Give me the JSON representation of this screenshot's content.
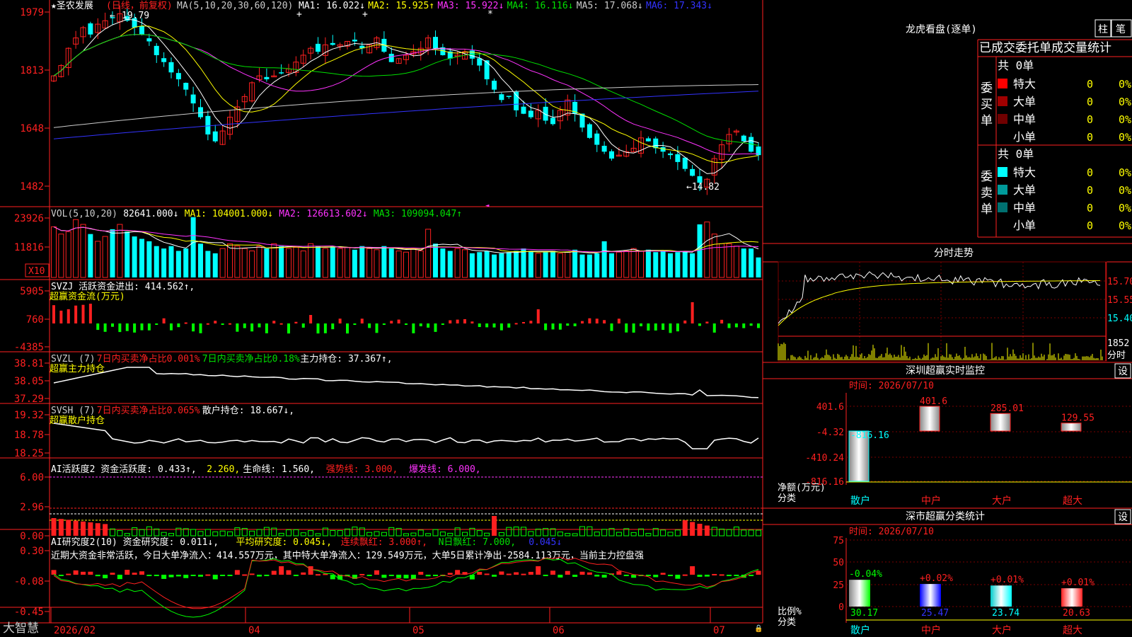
{
  "app": {
    "brand": "大智慧"
  },
  "stock": {
    "name": "★圣农发展",
    "period": "(日线，前复权)"
  },
  "price_panel": {
    "indicator": "MA(5,10,20,30,60,120)",
    "ma": [
      {
        "label": "MA1:",
        "value": "16.022",
        "arrow": "↓",
        "color": "#ffffff"
      },
      {
        "label": "MA2:",
        "value": "15.925",
        "arrow": "↑",
        "color": "#ffff00"
      },
      {
        "label": "MA3:",
        "value": "15.922",
        "arrow": "↓",
        "color": "#ff33ff"
      },
      {
        "label": "MA4:",
        "value": "16.116",
        "arrow": "↓",
        "color": "#00e000"
      },
      {
        "label": "MA5:",
        "value": "17.068",
        "arrow": "↓",
        "color": "#cccccc"
      },
      {
        "label": "MA6:",
        "value": "17.343",
        "arrow": "↓",
        "color": "#3333ff"
      }
    ],
    "yticks": [
      "1979",
      "1813",
      "1648",
      "1482"
    ],
    "high_label": "19.79",
    "low_label": "←14.82"
  },
  "vol_panel": {
    "header": [
      {
        "text": "VOL(5,10,20)",
        "color": "#cccccc"
      },
      {
        "text": "82641.000↓",
        "color": "#ffffff"
      },
      {
        "text": "MA1: 104001.000↓",
        "color": "#ffff00"
      },
      {
        "text": "MA2: 126613.602↓",
        "color": "#ff33ff"
      },
      {
        "text": "MA3: 109094.047↑",
        "color": "#00e000"
      }
    ],
    "yticks": [
      "23926",
      "11816"
    ],
    "unit": "X10"
  },
  "svzj_panel": {
    "header": [
      {
        "text": "SVZJ  活跃资金进出: 414.562↑,",
        "color": "#ffffff"
      }
    ],
    "subtitle": "超赢资金流(万元)",
    "yticks": [
      "5905",
      "760",
      "-4385"
    ]
  },
  "svzl_panel": {
    "header": [
      {
        "text": "SVZL (7)",
        "color": "#cccccc"
      },
      {
        "text": "7日内买卖净占比0.001%",
        "color": "#ff2020"
      },
      {
        "text": "7日内买卖净占比0.18%",
        "color": "#00e000"
      },
      {
        "text": "主力持仓: 37.367↑,",
        "color": "#ffffff"
      }
    ],
    "subtitle": "超赢主力持仓",
    "yticks": [
      "38.81",
      "38.05",
      "37.29"
    ]
  },
  "svsh_panel": {
    "header": [
      {
        "text": "SVSH (7)",
        "color": "#cccccc"
      },
      {
        "text": "7日内买卖净占比0.065%",
        "color": "#ff2020"
      },
      {
        "text": "散户持仓: 18.667↓,",
        "color": "#ffffff"
      }
    ],
    "subtitle": "超赢散户持仓",
    "yticks": [
      "19.32",
      "18.78",
      "18.25"
    ]
  },
  "ai2_panel": {
    "header": [
      {
        "text": "AI活跃度2 资金活跃度: 0.433↑,",
        "color": "#ffffff"
      },
      {
        "text": "2.260,",
        "color": "#ffff00"
      },
      {
        "text": "生命线: 1.560,",
        "color": "#ffffff"
      },
      {
        "text": "强势线: 3.000,",
        "color": "#ff2020"
      },
      {
        "text": "爆发线: 6.000,",
        "color": "#ff33ff"
      }
    ],
    "yticks": [
      "6.00",
      "2.96",
      "0.00"
    ]
  },
  "ai_research_panel": {
    "header": [
      {
        "text": "AI研究度2(10) 资金研究度: 0.011↓,",
        "color": "#ffffff"
      },
      {
        "text": "平均研究度: 0.045↓,",
        "color": "#ffff00"
      },
      {
        "text": "连续飘红: 3.000↑,",
        "color": "#ff2020"
      },
      {
        "text": "N日飘红: 7.000,",
        "color": "#00e000"
      },
      {
        "text": "0.045↓",
        "color": "#3333ff"
      }
    ],
    "comment": "近期大资金非常活跃，今日大单净流入：414.557万元，其中特大单净流入：129.549万元，大单5日累计净出-2584.113万元，当前主力控盘强",
    "yticks": [
      "0.30",
      "-0.08",
      "-0.45"
    ]
  },
  "xaxis": {
    "labels": [
      "2026/02",
      "04",
      "05",
      "06",
      "07"
    ]
  },
  "lhb": {
    "title": "龙虎看盘(逐单)",
    "tabs": [
      "柱",
      "笔"
    ],
    "stats_header": "已成交委托单成交量统计",
    "buy": {
      "label": "委买单",
      "count": "共 0单",
      "rows": [
        {
          "name": "特大",
          "count": "0",
          "pct": "0%",
          "color": "#ff0000"
        },
        {
          "name": "大单",
          "count": "0",
          "pct": "0%",
          "color": "#a00000"
        },
        {
          "name": "中单",
          "count": "0",
          "pct": "0%",
          "color": "#700000"
        },
        {
          "name": "小单",
          "count": "0",
          "pct": "0%",
          "color": "#000000"
        }
      ]
    },
    "sell": {
      "label": "委卖单",
      "count": "共 0单",
      "rows": [
        {
          "name": "特大",
          "count": "0",
          "pct": "0%",
          "color": "#00ffff"
        },
        {
          "name": "大单",
          "count": "0",
          "pct": "0%",
          "color": "#009a9a"
        },
        {
          "name": "中单",
          "count": "0",
          "pct": "0%",
          "color": "#007070"
        },
        {
          "name": "小单",
          "count": "0",
          "pct": "0%",
          "color": "#000000"
        }
      ]
    }
  },
  "intraday": {
    "title": "分时走势",
    "yticks": [
      "15.70",
      "15.55",
      "15.40"
    ],
    "vol_label": "1852",
    "side_label": "分时"
  },
  "sz_monitor": {
    "title": "深圳超赢实时监控",
    "settings": "设",
    "time": "时间: 2026/07/10",
    "yticks": [
      "401.6",
      "-4.32",
      "-410.24",
      "-816.16"
    ],
    "ylabel": [
      "净额(万元)",
      "分类"
    ],
    "categories": [
      "散户",
      "中户",
      "大户",
      "超大"
    ],
    "values": [
      "-816.16",
      "401.6",
      "285.01",
      "129.55"
    ]
  },
  "sz_class": {
    "title": "深市超赢分类统计",
    "settings": "设",
    "time": "时间: 2026/07/10",
    "yticks": [
      "75",
      "50",
      "25",
      "0"
    ],
    "ylabel": [
      "比例%",
      "分类"
    ],
    "categories": [
      "散户",
      "中户",
      "大户",
      "超大"
    ],
    "changes": [
      "-0.04%",
      "+0.02%",
      "+0.01%",
      "+0.01%"
    ],
    "values": [
      "30.17",
      "25.47",
      "23.74",
      "20.63"
    ]
  },
  "chart_data": [
    {
      "type": "candlestick",
      "title": "圣农发展 日线 前复权",
      "ylim": [
        14.5,
        20.0
      ],
      "x_labels": [
        "2026/02",
        "04",
        "05",
        "06",
        "07"
      ],
      "high": 19.79,
      "low": 14.82,
      "close": [
        18.0,
        18.3,
        18.8,
        19.1,
        19.4,
        19.2,
        19.5,
        19.6,
        19.7,
        19.8,
        19.6,
        19.4,
        19.2,
        19.0,
        18.6,
        18.4,
        18.1,
        17.9,
        17.6,
        17.2,
        16.8,
        16.3,
        16.1,
        16.4,
        16.8,
        17.1,
        17.4,
        17.8,
        18.0,
        17.9,
        18.0,
        18.1,
        18.2,
        18.4,
        18.6,
        18.8,
        18.7,
        18.9,
        18.9,
        18.9,
        19.0,
        19.0,
        18.8,
        18.9,
        19.1,
        18.7,
        18.4,
        18.5,
        18.6,
        18.7,
        18.8,
        19.1,
        18.8,
        18.6,
        18.5,
        18.6,
        18.7,
        18.5,
        18.3,
        17.9,
        17.6,
        17.3,
        17.4,
        17.0,
        16.9,
        16.8,
        17.0,
        16.7,
        16.6,
        17.0,
        17.3,
        16.9,
        16.5,
        16.2,
        16.0,
        15.8,
        15.6,
        15.7,
        15.8,
        15.9,
        16.2,
        16.1,
        15.9,
        15.8,
        15.7,
        15.5,
        15.3,
        15.1,
        14.9,
        15.0,
        15.6,
        16.0,
        16.3,
        16.4,
        16.1,
        15.8,
        15.7
      ],
      "ma_current": {
        "MA1": 16.022,
        "MA2": 15.925,
        "MA3": 15.922,
        "MA4": 16.116,
        "MA5": 17.068,
        "MA6": 17.343
      }
    },
    {
      "type": "bar",
      "title": "VOL(5,10,20)",
      "ylim": [
        0,
        27000
      ],
      "values": [
        21000,
        18000,
        19000,
        24000,
        22000,
        18000,
        15000,
        17000,
        20000,
        22000,
        19000,
        17000,
        16000,
        15000,
        13000,
        12000,
        13000,
        11000,
        12000,
        25000,
        14000,
        11000,
        10000,
        12000,
        14000,
        13000,
        12000,
        11000,
        13000,
        12000,
        14000,
        13000,
        12000,
        12500,
        11000,
        14000,
        13000,
        12000,
        13000,
        12000,
        12500,
        11500,
        13000,
        12000,
        11500,
        13000,
        12000,
        11000,
        10500,
        12000,
        11000,
        20000,
        14000,
        12000,
        11000,
        12000,
        11500,
        10000,
        10500,
        11000,
        9500,
        10000,
        10500,
        11000,
        12000,
        11000,
        10000,
        10500,
        11000,
        10000,
        10500,
        11500,
        9500,
        9500,
        10000,
        15000,
        10000,
        10500,
        11000,
        12000,
        11000,
        11500,
        10500,
        11000,
        10000,
        10500,
        11000,
        10000,
        22000,
        23000,
        18000,
        14000,
        14000,
        13000,
        12000,
        12000,
        8300
      ],
      "last": 82641.0
    }
  ]
}
